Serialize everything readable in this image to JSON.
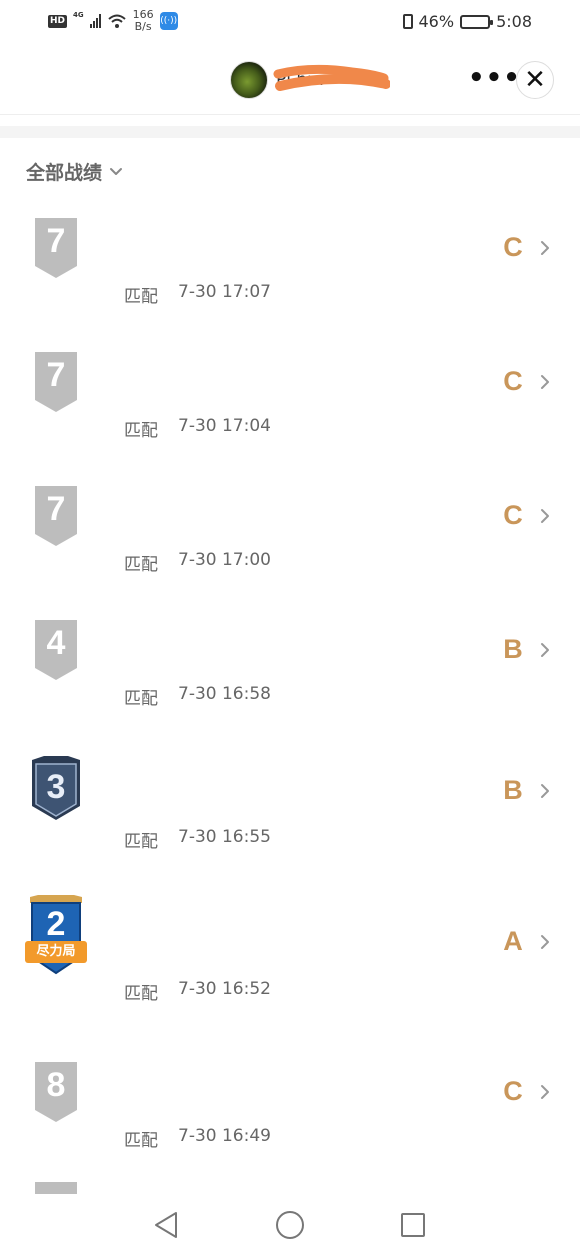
{
  "status_bar": {
    "hd": "HD",
    "network": "4G",
    "speed_value": "166",
    "speed_unit": "B/s",
    "battery_text": "46%",
    "battery_level": 0.46,
    "clock": "5:08"
  },
  "header": {
    "user_name": "Pl    hm"
  },
  "filter": {
    "label": "全部战绩"
  },
  "colors": {
    "grade": "#c9965a",
    "badge_gray": "#bdbdbd",
    "badge_dark": "#3e5473",
    "badge_blue": "#1e64b4",
    "tag_orange": "#f29a2b"
  },
  "matches": [
    {
      "rank": "7",
      "mode": "匹配",
      "time": "7-30 17:07",
      "grade": "C",
      "style": "gray"
    },
    {
      "rank": "7",
      "mode": "匹配",
      "time": "7-30 17:04",
      "grade": "C",
      "style": "gray"
    },
    {
      "rank": "7",
      "mode": "匹配",
      "time": "7-30 17:00",
      "grade": "C",
      "style": "gray"
    },
    {
      "rank": "4",
      "mode": "匹配",
      "time": "7-30 16:58",
      "grade": "B",
      "style": "gray"
    },
    {
      "rank": "3",
      "mode": "匹配",
      "time": "7-30 16:55",
      "grade": "B",
      "style": "dark"
    },
    {
      "rank": "2",
      "mode": "匹配",
      "time": "7-30 16:52",
      "grade": "A",
      "style": "blue",
      "tag": "尽力局"
    },
    {
      "rank": "8",
      "mode": "匹配",
      "time": "7-30 16:49",
      "grade": "C",
      "style": "gray"
    }
  ]
}
